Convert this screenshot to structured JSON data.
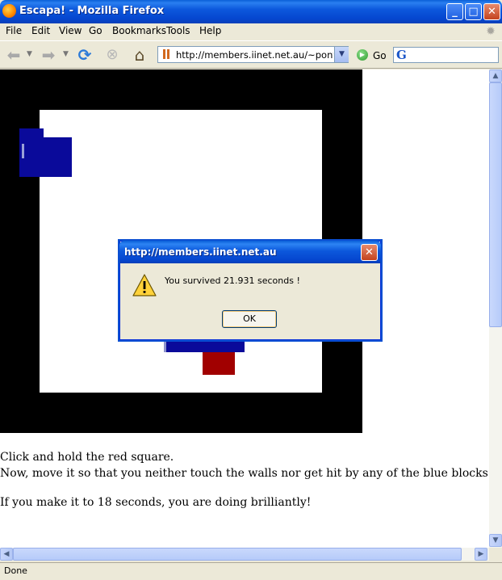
{
  "window": {
    "title": "Escapa! - Mozilla Firefox",
    "minimize_glyph": "_",
    "maximize_glyph": "□",
    "close_glyph": "✕"
  },
  "menu": {
    "items": [
      "File",
      "Edit",
      "View",
      "Go",
      "Bookmarks",
      "Tools",
      "Help"
    ]
  },
  "toolbar": {
    "url": "http://members.iinet.net.au/~pontipak/",
    "go_label": "Go",
    "search_value": ""
  },
  "page": {
    "instructions": [
      "Click and hold the red square.",
      "Now, move it so that you neither touch the walls nor get hit by any of the blue blocks",
      "If you make it to 18 seconds, you are doing brilliantly!"
    ],
    "colors": {
      "wall": "#000000",
      "blue_block": "#0a0a9a",
      "red_square": "#a10000"
    }
  },
  "dialog": {
    "title": "http://members.iinet.net.au",
    "message": "You survived 21.931 seconds !",
    "ok_label": "OK",
    "icon": "warning-icon"
  },
  "status": {
    "text": "Done"
  }
}
